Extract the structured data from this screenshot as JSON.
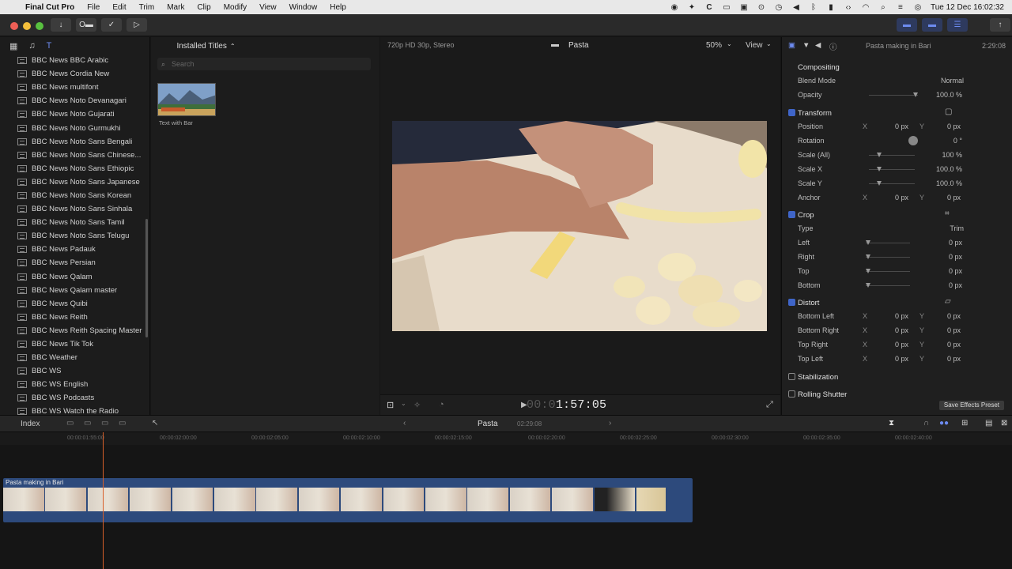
{
  "menubar": {
    "app_name": "Final Cut Pro",
    "items": [
      "File",
      "Edit",
      "Trim",
      "Mark",
      "Clip",
      "Modify",
      "View",
      "Window",
      "Help"
    ],
    "clock": "Tue 12 Dec  16:02:32"
  },
  "sidebar": {
    "items": [
      "BBC News BBC Arabic",
      "BBC News Cordia New",
      "BBC News multifont",
      "BBC News Noto Devanagari",
      "BBC News Noto Gujarati",
      "BBC News Noto Gurmukhi",
      "BBC News Noto Sans Bengali",
      "BBC News Noto Sans Chinese...",
      "BBC News Noto Sans Ethiopic",
      "BBC News Noto Sans Japanese",
      "BBC News Noto Sans Korean",
      "BBC News Noto Sans Sinhala",
      "BBC News Noto Sans Tamil",
      "BBC News Noto Sans Telugu",
      "BBC News Padauk",
      "BBC News Persian",
      "BBC News Qalam",
      "BBC News Qalam master",
      "BBC News Quibi",
      "BBC News Reith",
      "BBC News Reith Spacing Master",
      "BBC News Tik Tok",
      "BBC Weather",
      "BBC WS",
      "BBC WS English",
      "BBC WS Podcasts",
      "BBC WS Watch the Radio"
    ]
  },
  "browser": {
    "title": "Installed Titles",
    "search_placeholder": "Search",
    "thumb_label": "Text with Bar"
  },
  "viewer": {
    "format": "720p HD 30p, Stereo",
    "project": "Pasta",
    "zoom": "50%",
    "view_label": "View",
    "timecode_dim": "00:0",
    "timecode": "1:57:05"
  },
  "inspector": {
    "clip_name": "Pasta making in Bari",
    "duration": "2:29:08",
    "compositing": "Compositing",
    "blend_mode_label": "Blend Mode",
    "blend_mode": "Normal",
    "opacity_label": "Opacity",
    "opacity": "100.0 %",
    "transform": "Transform",
    "position_label": "Position",
    "position_x": "0 px",
    "position_y": "0 px",
    "rotation_label": "Rotation",
    "rotation": "0 °",
    "scale_all_label": "Scale (All)",
    "scale_all": "100 %",
    "scale_x_label": "Scale X",
    "scale_x": "100.0 %",
    "scale_y_label": "Scale Y",
    "scale_y": "100.0 %",
    "anchor_label": "Anchor",
    "anchor_x": "0 px",
    "anchor_y": "0 px",
    "crop": "Crop",
    "type_label": "Type",
    "type_value": "Trim",
    "left_label": "Left",
    "left": "0 px",
    "right_label": "Right",
    "right": "0 px",
    "top_label": "Top",
    "top": "0 px",
    "bottom_label": "Bottom",
    "bottom": "0 px",
    "distort": "Distort",
    "bl_label": "Bottom Left",
    "br_label": "Bottom Right",
    "tr_label": "Top Right",
    "tl_label": "Top Left",
    "zero_px": "0 px",
    "stabilization": "Stabilization",
    "rolling_shutter": "Rolling Shutter",
    "save_preset": "Save Effects Preset"
  },
  "timeline": {
    "index_label": "Index",
    "project": "Pasta",
    "duration": "02:29:08",
    "ruler": [
      "00:00:01:55:00",
      "00:00:02:00:00",
      "00:00:02:05:00",
      "00:00:02:10:00",
      "00:00:02:15:00",
      "00:00:02:20:00",
      "00:00:02:25:00",
      "00:00:02:30:00",
      "00:00:02:35:00",
      "00:00:02:40:00"
    ],
    "clip_title": "Pasta making in Bari"
  },
  "colors": {
    "accent": "#3f65c8",
    "clip": "#2d4a7c",
    "playhead": "#d8602a"
  }
}
